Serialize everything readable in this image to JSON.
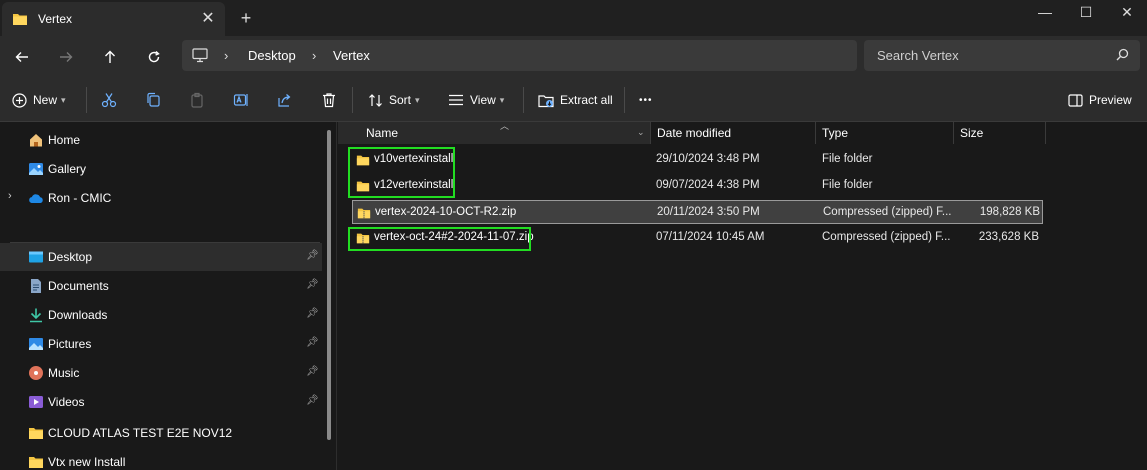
{
  "window": {
    "tab_title": "Vertex",
    "tab_close": "✕",
    "new_tab": "+",
    "minimize": "—",
    "maximize": "☐",
    "close": "✕"
  },
  "navbar": {
    "breadcrumb": [
      "Desktop",
      "Vertex"
    ],
    "separator": "›",
    "search_placeholder": "Search Vertex"
  },
  "commands": {
    "new": "New",
    "sort": "Sort",
    "view": "View",
    "extract_all": "Extract all",
    "more": "•••",
    "preview": "Preview"
  },
  "sidebar": {
    "quick": [
      {
        "label": "Home",
        "icon": "home-icon"
      },
      {
        "label": "Gallery",
        "icon": "gallery-icon"
      },
      {
        "label": "Ron - CMIC",
        "icon": "onedrive-icon",
        "expandable": true
      }
    ],
    "pinned": [
      {
        "label": "Desktop",
        "icon": "desktop-icon",
        "pinned": true,
        "selected": true
      },
      {
        "label": "Documents",
        "icon": "documents-icon",
        "pinned": true
      },
      {
        "label": "Downloads",
        "icon": "downloads-icon",
        "pinned": true
      },
      {
        "label": "Pictures",
        "icon": "pictures-icon",
        "pinned": true
      },
      {
        "label": "Music",
        "icon": "music-icon",
        "pinned": true
      },
      {
        "label": "Videos",
        "icon": "videos-icon",
        "pinned": true
      },
      {
        "label": "CLOUD ATLAS TEST E2E NOV12",
        "icon": "folder-icon"
      },
      {
        "label": "Vtx new Install",
        "icon": "folder-icon"
      }
    ],
    "expander": "›"
  },
  "columns": {
    "name": "Name",
    "date": "Date modified",
    "type": "Type",
    "size": "Size"
  },
  "files": [
    {
      "name": "v10vertexinstall",
      "date": "29/10/2024 3:48 PM",
      "type": "File folder",
      "size": ""
    },
    {
      "name": "v12vertexinstall",
      "date": "09/07/2024 4:38 PM",
      "type": "File folder",
      "size": ""
    },
    {
      "name": "vertex-2024-10-OCT-R2.zip",
      "date": "20/11/2024 3:50 PM",
      "type": "Compressed (zipped) F...",
      "size": "198,828 KB"
    },
    {
      "name": "vertex-oct-24#2-2024-11-07.zip",
      "date": "07/11/2024 10:45 AM",
      "type": "Compressed (zipped) F...",
      "size": "233,628 KB"
    }
  ],
  "colors": {
    "highlight": "#22dd22",
    "folder": "#f4c542",
    "background": "#191919"
  }
}
